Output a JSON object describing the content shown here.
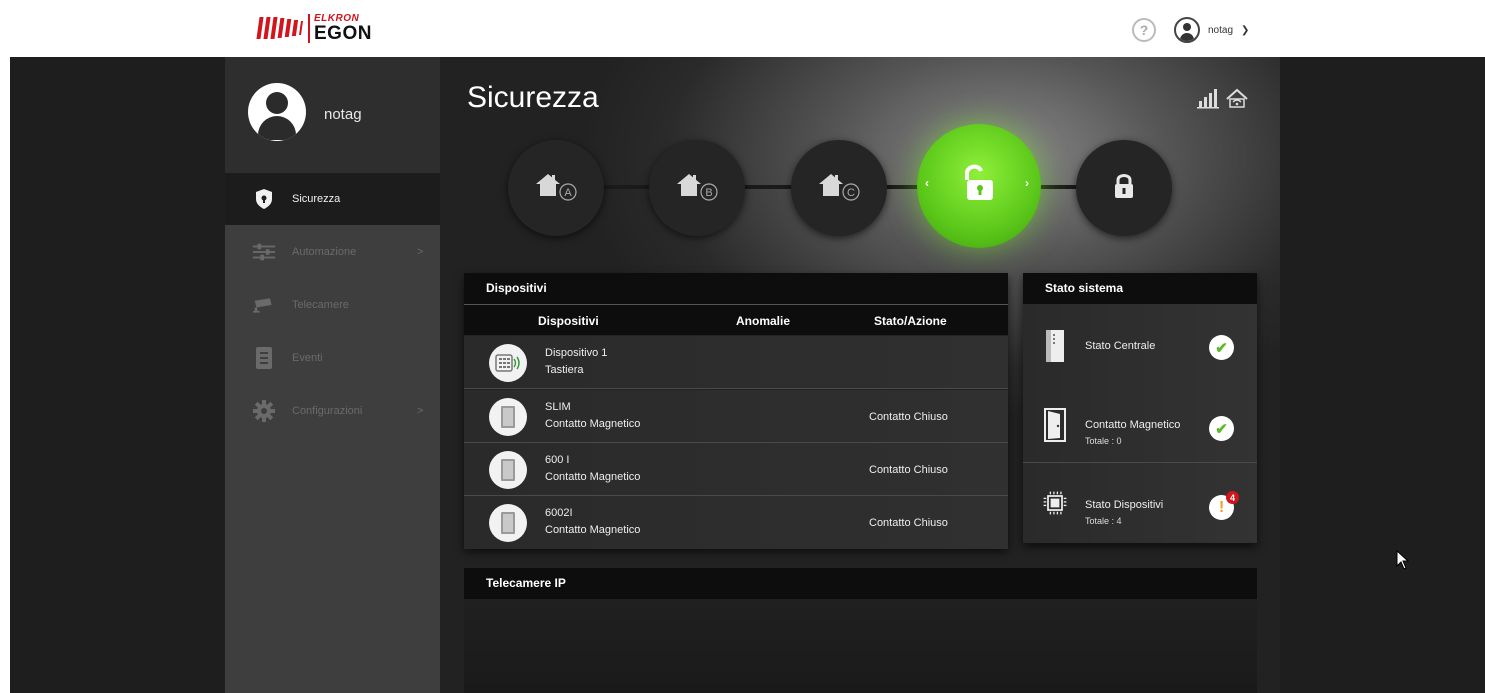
{
  "header": {
    "logo": {
      "brand_top": "ELKRON",
      "brand_main": "EGON"
    },
    "help_icon": "question-circle-icon",
    "user": {
      "name": "notag",
      "icon": "user-circle-icon",
      "dropdown_icon": "chevron-down-icon"
    }
  },
  "sidebar": {
    "username": "notag",
    "items": [
      {
        "label": "Sicurezza",
        "icon": "shield-icon",
        "active": true,
        "has_arrow": false
      },
      {
        "label": "Automazione",
        "icon": "sliders-icon",
        "active": false,
        "has_arrow": true,
        "arrow": ">"
      },
      {
        "label": "Telecamere",
        "icon": "camera-icon",
        "active": false,
        "has_arrow": false
      },
      {
        "label": "Eventi",
        "icon": "list-icon",
        "active": false,
        "has_arrow": false
      },
      {
        "label": "Configurazioni",
        "icon": "gear-icon",
        "active": false,
        "has_arrow": true,
        "arrow": ">"
      }
    ]
  },
  "main": {
    "title": "Sicurezza",
    "header_icons": [
      "signal-icon",
      "home-network-icon"
    ],
    "modes": [
      {
        "name": "partial-a",
        "icon": "home-a-icon",
        "letter": "A"
      },
      {
        "name": "partial-b",
        "icon": "home-b-icon",
        "letter": "B"
      },
      {
        "name": "partial-c",
        "icon": "home-c-icon",
        "letter": "C"
      },
      {
        "name": "disarmed",
        "icon": "unlocked-icon",
        "active": true,
        "prev": "‹",
        "next": "›"
      },
      {
        "name": "armed",
        "icon": "lock-icon"
      }
    ],
    "devices_panel": {
      "title": "Dispositivi",
      "columns": [
        "Dispositivi",
        "Anomalie",
        "Stato/Azione"
      ],
      "rows": [
        {
          "name": "Dispositivo 1",
          "type": "Tastiera",
          "anomaly": "",
          "state": "",
          "icon": "keypad-icon"
        },
        {
          "name": "SLIM",
          "type": "Contatto Magnetico",
          "anomaly": "",
          "state": "Contatto Chiuso",
          "icon": "magnetic-contact-icon"
        },
        {
          "name": "600 I",
          "type": "Contatto Magnetico",
          "anomaly": "",
          "state": "Contatto Chiuso",
          "icon": "magnetic-contact-icon"
        },
        {
          "name": "6002I",
          "type": "Contatto Magnetico",
          "anomaly": "",
          "state": "Contatto Chiuso",
          "icon": "magnetic-contact-icon"
        }
      ]
    },
    "system_panel": {
      "title": "Stato sistema",
      "rows": [
        {
          "title": "Stato Centrale",
          "sub": "",
          "icon": "control-panel-icon",
          "status": "ok",
          "status_glyph": "✔"
        },
        {
          "title": "Contatto Magnetico",
          "sub": "Totale :  0",
          "icon": "door-icon",
          "status": "ok",
          "status_glyph": "✔"
        },
        {
          "title": "Stato Dispositivi",
          "sub": "Totale :  4",
          "icon": "chip-icon",
          "status": "warning",
          "status_glyph": "!",
          "count": "4"
        }
      ]
    },
    "cameras_panel": {
      "title": "Telecamere IP"
    }
  },
  "colors": {
    "brand_red": "#d2141c",
    "active_green": "#5cc81a",
    "ok_green": "#5cb82a",
    "warning_orange": "#f0a020",
    "sidebar_bg": "#3e3e3e",
    "panel_header": "#0d0d0d"
  }
}
